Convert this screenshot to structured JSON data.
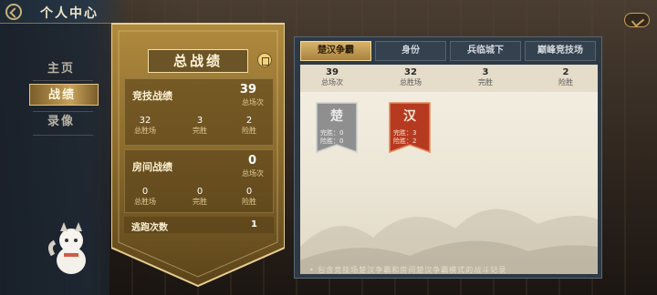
{
  "header": {
    "title": "个人中心"
  },
  "nav": {
    "items": [
      {
        "label": "主页"
      },
      {
        "label": "战绩"
      },
      {
        "label": "录像"
      }
    ],
    "active": 1
  },
  "summary_panel": {
    "title": "总战绩",
    "ranked": {
      "title": "竞技战绩",
      "total": "39",
      "total_label": "总场次",
      "stats": [
        {
          "value": "32",
          "label": "总胜场"
        },
        {
          "value": "3",
          "label": "完胜"
        },
        {
          "value": "2",
          "label": "险胜"
        }
      ]
    },
    "room": {
      "title": "房间战绩",
      "total": "0",
      "total_label": "总场次",
      "stats": [
        {
          "value": "0",
          "label": "总胜场"
        },
        {
          "value": "0",
          "label": "完胜"
        },
        {
          "value": "0",
          "label": "险胜"
        }
      ]
    },
    "escape": {
      "label": "逃跑次数",
      "value": "1"
    }
  },
  "tabs": [
    {
      "label": "楚汉争霸"
    },
    {
      "label": "身份"
    },
    {
      "label": "兵临城下"
    },
    {
      "label": "巅峰竞技场"
    }
  ],
  "detail": {
    "summary": [
      {
        "value": "39",
        "label": "总场次"
      },
      {
        "value": "32",
        "label": "总胜场"
      },
      {
        "value": "3",
        "label": "完胜"
      },
      {
        "value": "2",
        "label": "险胜"
      }
    ],
    "flags": [
      {
        "name": "楚",
        "line1": "完胜：0",
        "line2": "险胜：0",
        "color": "#9a9a9a"
      },
      {
        "name": "汉",
        "line1": "完胜：3",
        "line2": "险胜：2",
        "color": "#b83a22"
      }
    ],
    "footer": "• 包含竞技场楚汉争霸和房间楚汉争霸模式的战斗记录"
  }
}
